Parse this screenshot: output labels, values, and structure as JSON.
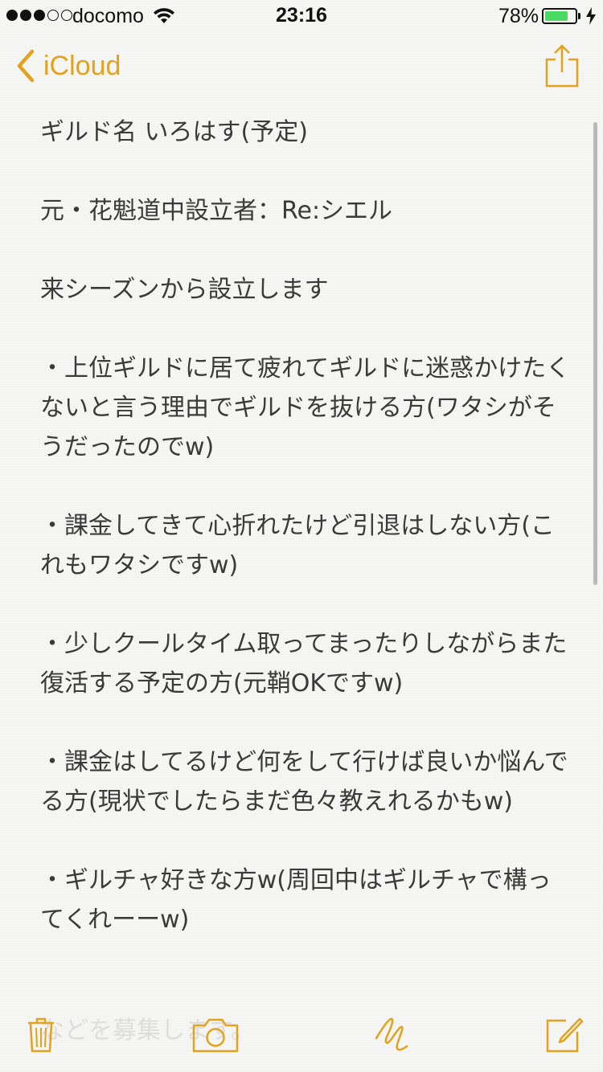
{
  "status_bar": {
    "carrier": "docomo",
    "time": "23:16",
    "battery_percent": "78%",
    "battery_level": 0.78,
    "signal_bars_filled": 3,
    "signal_bars_total": 5,
    "charging": true
  },
  "nav": {
    "back_label": "iCloud",
    "back_icon": "chevron-left-icon",
    "share_icon": "share-icon",
    "accent_color": "#e2a21d"
  },
  "note": {
    "paragraphs": [
      "ギルド名 いろはす(予定)",
      "元・花魁道中設立者：Re:シエル",
      "来シーズンから設立します",
      "・上位ギルドに居て疲れてギルドに迷惑かけたくないと言う理由でギルドを抜ける方(ワタシがそうだったのでw)",
      "・課金してきて心折れたけど引退はしない方(これもワタシですw)",
      "・少しクールタイム取ってまったりしながらまた復活する予定の方(元鞘OKですw)",
      "・課金はしてるけど何をして行けば良いか悩んでる方(現状でしたらまだ色々教えれるかもw)",
      "・ギルチャ好きな方w(周回中はギルチャで構ってくれーーw)"
    ],
    "partial_line": "などを募集します。"
  },
  "toolbar": {
    "trash_icon": "trash-icon",
    "camera_icon": "camera-icon",
    "sketch_icon": "sketch-icon",
    "compose_icon": "compose-icon"
  }
}
